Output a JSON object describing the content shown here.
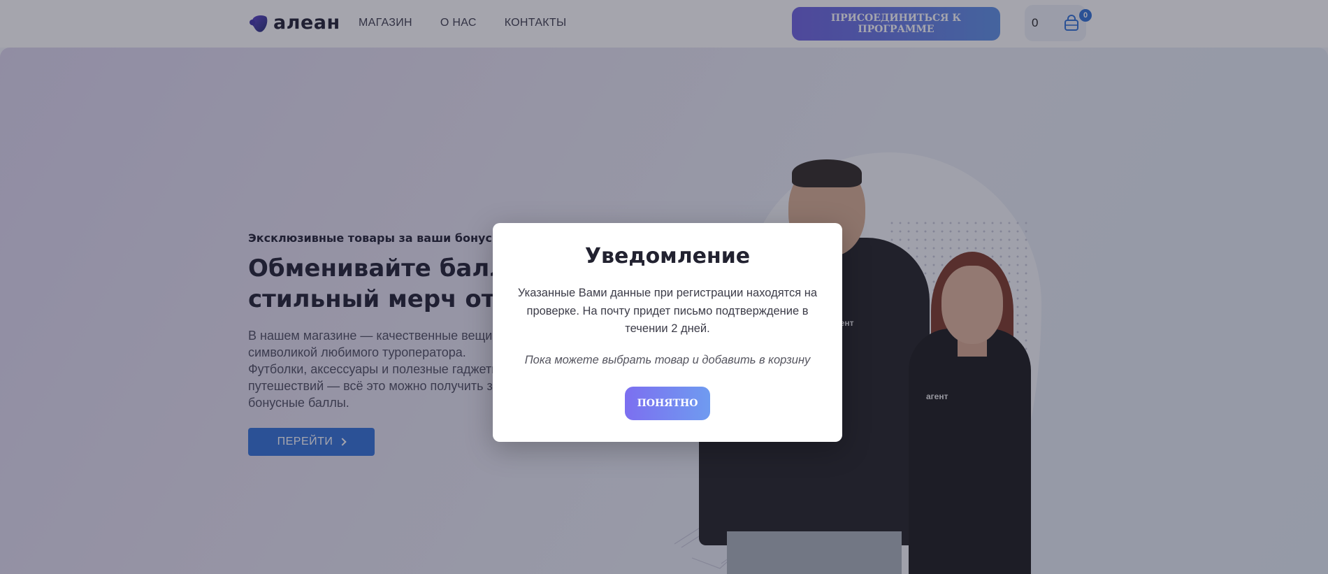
{
  "header": {
    "logo_text": "алеан",
    "nav": [
      "МАГАЗИН",
      "О НАС",
      "КОНТАКТЫ"
    ],
    "join_button": "ПРИСОЕДИНИТЬСЯ К ПРОГРАММЕ",
    "cart_total": "0",
    "cart_badge": "0"
  },
  "hero": {
    "kicker": "Эксклюзивные товары за ваши бонусные баллы",
    "title_line1": "Обменивайте баллы на",
    "title_line2": "стильный мерч от Алеан",
    "text": "В нашем магазине — качественные вещи с символикой любимого туроператора. Футболки, аксессуары и полезные гаджеты для путешествий — всё это можно получить за бонусные баллы.",
    "button": "ПЕРЕЙТИ",
    "tshirt_logo_man": "агент",
    "tshirt_logo_woman": "агент"
  },
  "modal": {
    "title": "Уведомление",
    "text": "Указанные Вами данные при регистрации находятся на проверке. На почту придет письмо подтверждение в течении 2 дней.",
    "hint": "Пока можете выбрать товар и добавить в корзину",
    "button": "ПОНЯТНО"
  },
  "colors": {
    "accent": "#2e6fd8",
    "join_gradient_start": "#6a5fe0",
    "join_gradient_end": "#5a8fe6",
    "overlay": "rgba(40,40,60,0.42)"
  }
}
